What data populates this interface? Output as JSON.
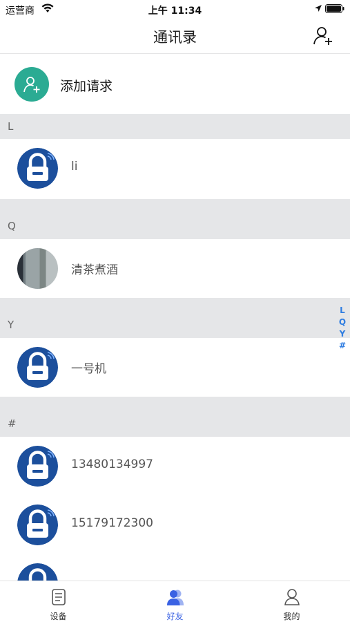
{
  "status_bar": {
    "carrier": "运营商",
    "time": "上午 11:34"
  },
  "nav": {
    "title": "通讯录",
    "add_icon": "add-user-icon"
  },
  "add_request": {
    "label": "添加请求",
    "icon": "add-user-icon",
    "color": "#2bab93"
  },
  "sections": [
    {
      "letter": "L",
      "contacts": [
        {
          "name": "li",
          "avatar": "lock-icon"
        }
      ]
    },
    {
      "letter": "Q",
      "contacts": [
        {
          "name": "清茶煮酒",
          "avatar": "photo"
        }
      ]
    },
    {
      "letter": "Y",
      "contacts": [
        {
          "name": "一号机",
          "avatar": "lock-icon"
        }
      ]
    },
    {
      "letter": "#",
      "contacts": [
        {
          "name": "13480134997",
          "avatar": "lock-icon"
        },
        {
          "name": "15179172300",
          "avatar": "lock-icon"
        }
      ]
    }
  ],
  "index_letters": [
    "L",
    "Q",
    "Y",
    "#"
  ],
  "tabs": [
    {
      "label": "设备",
      "icon": "device-list-icon",
      "active": false
    },
    {
      "label": "好友",
      "icon": "friends-icon",
      "active": true
    },
    {
      "label": "我的",
      "icon": "profile-icon",
      "active": false
    }
  ],
  "colors": {
    "accent": "#3a62e3",
    "index": "#2f7de1",
    "lock_blue": "#1c4f9c"
  }
}
